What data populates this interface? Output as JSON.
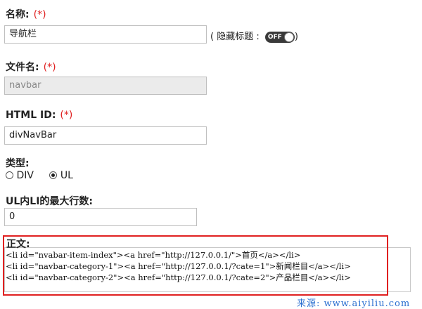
{
  "required_mark": "(*)",
  "name_field": {
    "label": "名称:",
    "value": "导航栏",
    "hide_title_label": "( 隐藏标题 :",
    "toggle_text": "OFF",
    "close_paren": ")"
  },
  "filename_field": {
    "label": "文件名:",
    "value": "navbar"
  },
  "html_id_field": {
    "label": "HTML ID:",
    "value": "divNavBar"
  },
  "type_field": {
    "label": "类型:",
    "options": [
      {
        "label": "DIV",
        "selected": false
      },
      {
        "label": "UL",
        "selected": true
      }
    ]
  },
  "max_rows_field": {
    "label": "UL内LI的最大行数:",
    "value": "0"
  },
  "body_field": {
    "label": "正文:",
    "lines": [
      "<li id=\"nvabar-item-index\"><a href=\"http://127.0.0.1/\">首页</a></li>",
      "<li id=\"navbar-category-1\"><a href=\"http://127.0.0.1/?cate=1\">新闻栏目</a></li>",
      "<li id=\"navbar-category-2\"><a href=\"http://127.0.0.1/?cate=2\">产品栏目</a></li>"
    ]
  },
  "watermark": "来源: www.aiyiliu.com",
  "colors": {
    "required": "#e02020",
    "highlight_frame": "#e02020",
    "watermark": "#2a6fd0",
    "toggle_bg": "#3a3a3a"
  }
}
